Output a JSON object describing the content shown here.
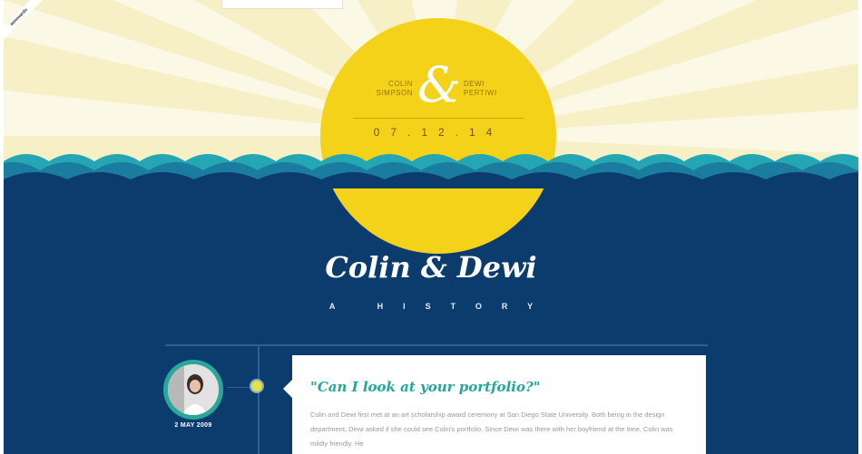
{
  "sun": {
    "left_name": "COLIN SIMPSON",
    "right_name": "DEWI PERTIWI",
    "ampersand": "&",
    "date": "07.12.14"
  },
  "hero": {
    "title": "Colin & Dewi",
    "subtitle": "A HISTORY"
  },
  "timeline": {
    "entries": [
      {
        "date": "2 MAY 2009",
        "quote": "\"Can I look at your portfolio?\"",
        "body": "Colin and Dewi first met at an art scholarship award ceremony at San Diego State University. Both being in the design department, Dewi asked if she could see Colin's portfolio. Since Dewi was there with her boyfriend at the time, Colin was mildly friendly. He"
      }
    ]
  },
  "ribbon": {
    "label": "awwwards"
  },
  "colors": {
    "ocean": "#0c3b6e",
    "sun": "#f4d21a",
    "teal": "#23a898",
    "sky": "#fbf5d6"
  }
}
